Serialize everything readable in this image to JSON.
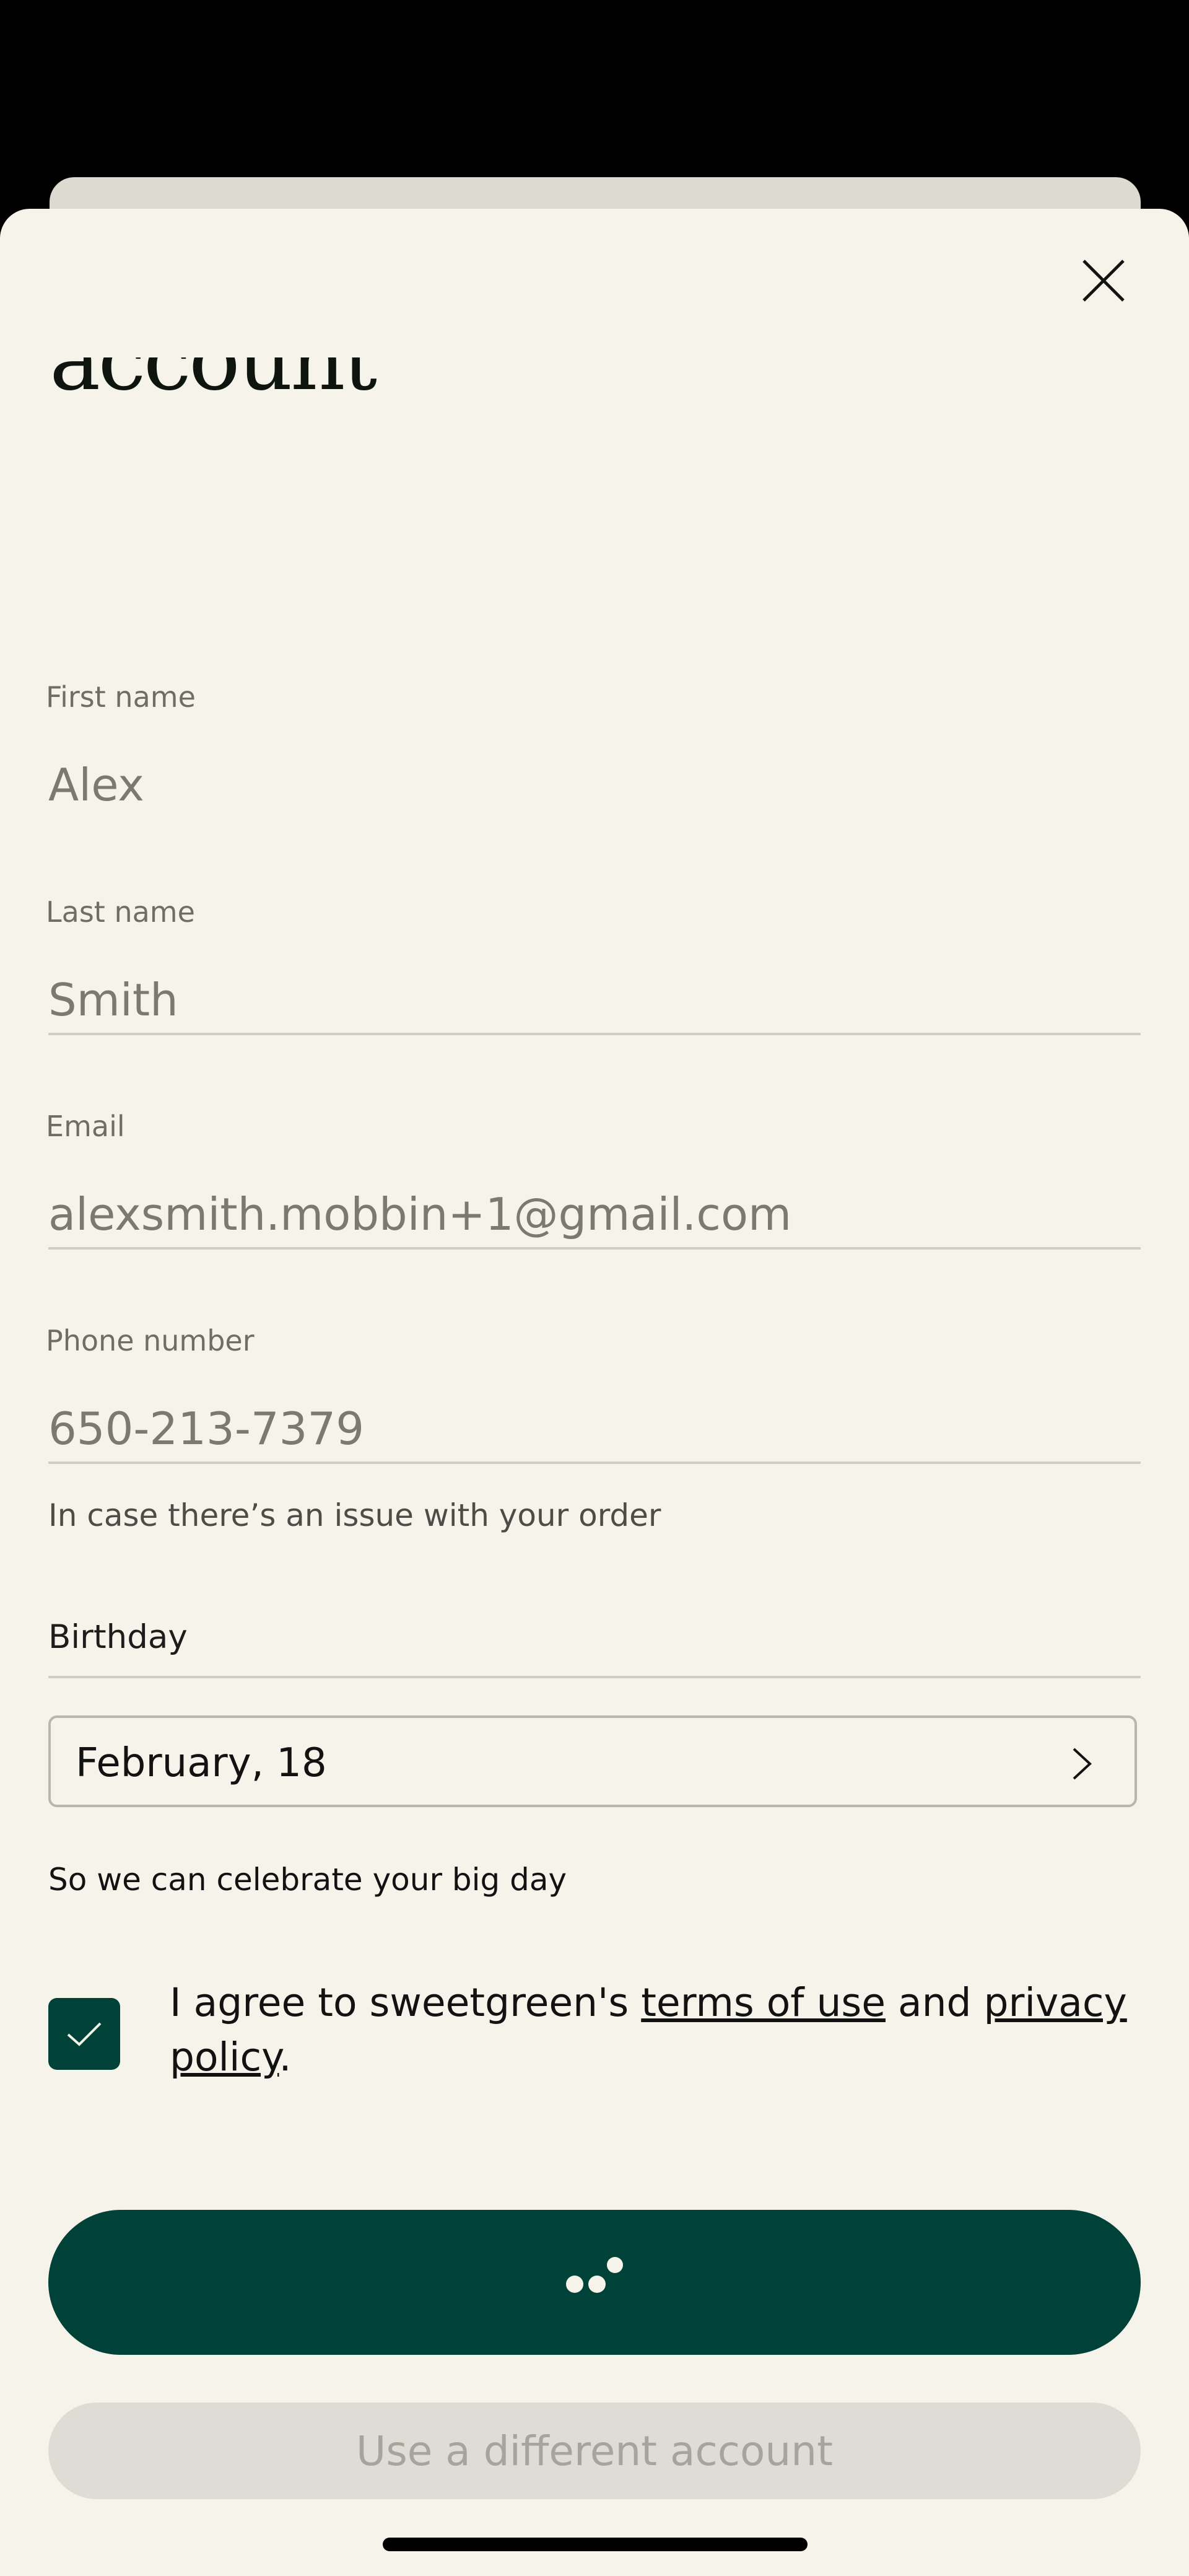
{
  "modal": {
    "title": "Welcome! Create your account"
  },
  "form": {
    "first_name": {
      "label": "First name",
      "value": "Alex"
    },
    "last_name": {
      "label": "Last name",
      "value": "Smith"
    },
    "email": {
      "label": "Email",
      "value": "alexsmith.mobbin+1@gmail.com"
    },
    "phone": {
      "label": "Phone number",
      "value": "650-213-7379",
      "helper": "In case there’s an issue with your order"
    },
    "birthday": {
      "label": "Birthday",
      "value": "February, 18",
      "helper": "So we can celebrate your big day"
    },
    "agreement": {
      "checked": true,
      "prefix": "I agree to sweetgreen's ",
      "terms_link": "terms of use",
      "middle": " and ",
      "privacy_link": "privacy policy",
      "suffix": "."
    }
  },
  "buttons": {
    "primary_state": "loading",
    "secondary_label": "Use a different account"
  },
  "colors": {
    "brand_green": "#004138",
    "sheet_background": "#f5f3ea"
  },
  "icons": {
    "close": "close-icon",
    "chevron": "chevron-right-icon",
    "check": "checkmark-icon",
    "loading": "loading-dots-icon"
  }
}
